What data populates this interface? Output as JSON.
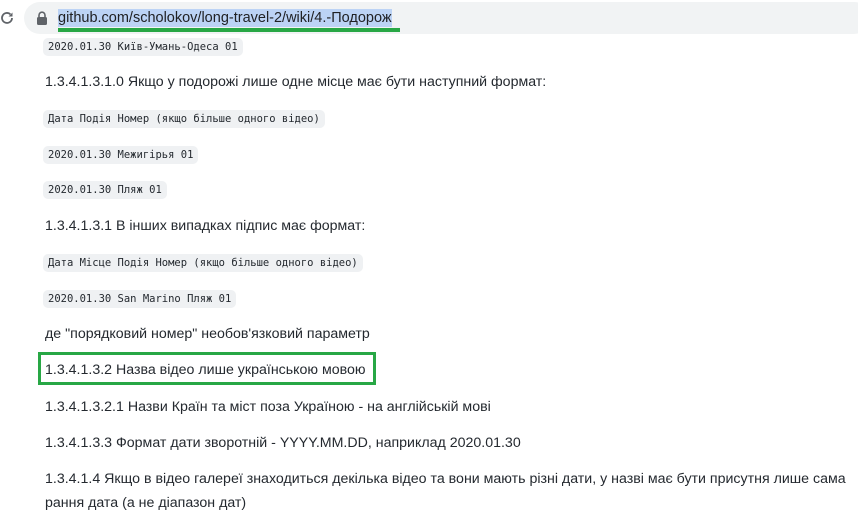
{
  "browser": {
    "url": "github.com/scholokov/long-travel-2/wiki/4.-Подорож",
    "highlight_color": "#28a745"
  },
  "content": {
    "code1": "2020.01.30 Київ-Умань-Одеса 01",
    "p1": "1.3.4.1.3.1.0 Якщо у подорожі лише одне місце має бути наступний формат:",
    "code2": "Дата Подія Номер (якщо більше одного відео)",
    "code3": "2020.01.30 Межигірья 01",
    "code4": "2020.01.30 Пляж 01",
    "p2": "1.3.4.1.3.1 В інших випадках підпис має формат:",
    "code5": "Дата Місце Подія Номер (якщо більше одного відео)",
    "code6": "2020.01.30 San Marino Пляж 01",
    "p3": "де \"порядковий номер\" необов'язковий параметр",
    "p4": "1.3.4.1.3.2 Назва відео лише українською мовою",
    "p5": "1.3.4.1.3.2.1 Назви Країн та міст поза Україною - на англійській мові",
    "p6": "1.3.4.1.3.3 Формат дати зворотній - YYYY.MM.DD, наприклад 2020.01.30",
    "p7": "1.3.4.1.4 Якщо в відео галереї знаходиться декілька відео та вони мають різні дати, у назві має бути присутня лише сама рання дата (а не діапазон дат)"
  }
}
